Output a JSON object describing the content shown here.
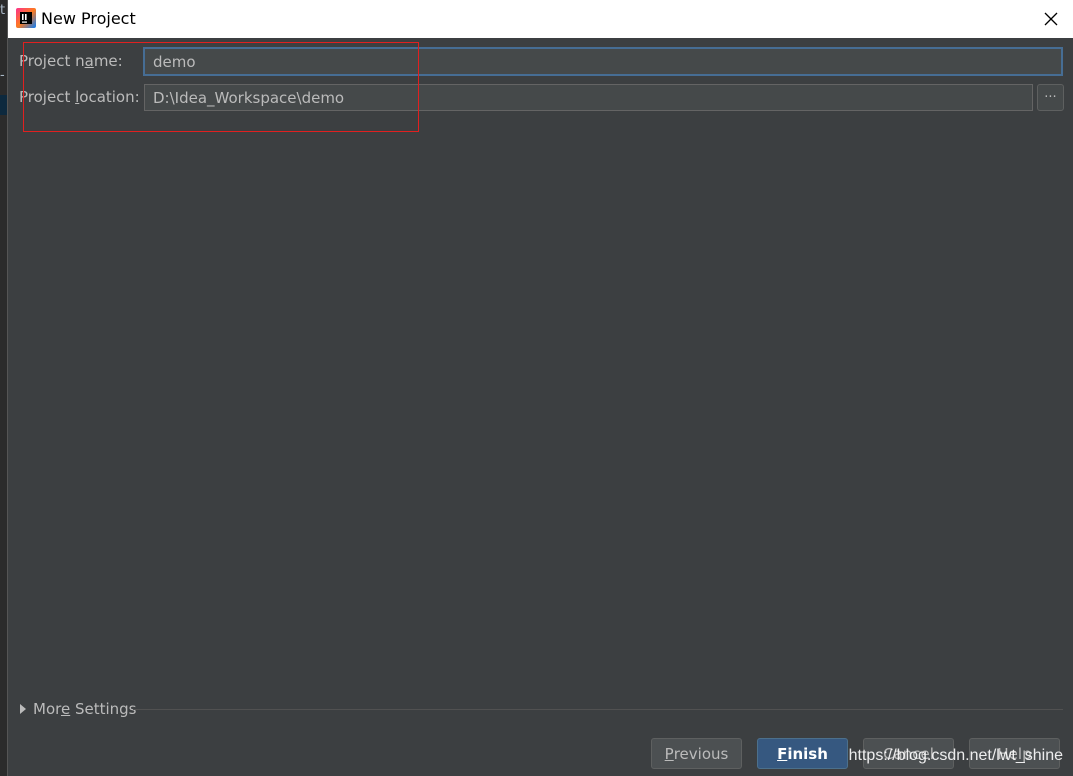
{
  "window": {
    "title": "New Project",
    "icon": "intellij-idea-icon"
  },
  "form": {
    "project_name": {
      "label_pre": "Project n",
      "label_mnemonic": "a",
      "label_post": "me:",
      "value": "demo"
    },
    "project_location": {
      "label_pre": "Project ",
      "label_mnemonic": "l",
      "label_post": "ocation:",
      "value": "D:\\Idea_Workspace\\demo",
      "browse_label": "···"
    }
  },
  "more_settings": {
    "label_pre": "Mor",
    "label_mnemonic": "e",
    "label_post": " Settings"
  },
  "buttons": {
    "previous": {
      "mnemonic": "P",
      "rest": "revious"
    },
    "finish": {
      "mnemonic": "F",
      "rest": "inish"
    },
    "cancel": "Cancel",
    "help": "Help"
  },
  "watermark": "https://blog.csdn.net/lwt_shine",
  "colors": {
    "dialog_bg": "#3c3f41",
    "field_bg": "#45494a",
    "focus_border": "#466d94",
    "primary_button": "#365880",
    "annotation_box": "#e02020"
  }
}
